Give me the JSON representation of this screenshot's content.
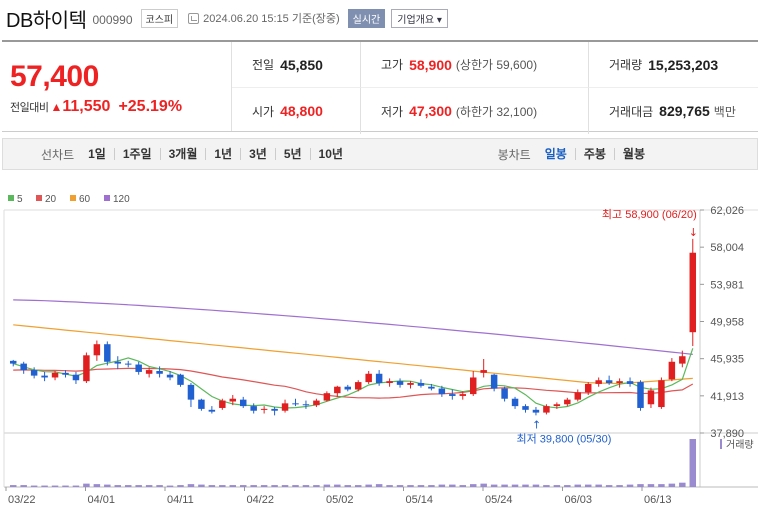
{
  "header": {
    "name": "DB하이텍",
    "code": "000990",
    "market": "코스피",
    "timestamp": "2024.06.20 15:15 기준(장중)",
    "realtime": "실시간",
    "company_info": "기업개요 ▾"
  },
  "quote": {
    "price": "57,400",
    "change_label": "전일대비",
    "change_arrow": "▲",
    "change": "11,550",
    "change_pct": "+25.19%",
    "prev_close_label": "전일",
    "prev_close": "45,850",
    "high_label": "고가",
    "high": "58,900",
    "upper_limit": "(상한가 59,600)",
    "volume_label": "거래량",
    "volume": "15,253,203",
    "open_label": "시가",
    "open": "48,800",
    "low_label": "저가",
    "low": "47,300",
    "lower_limit": "(하한가 32,100)",
    "value_label": "거래대금",
    "value": "829,765",
    "value_unit": "백만"
  },
  "period_bar": {
    "line_title": "선차트",
    "line_items": [
      "1일",
      "1주일",
      "3개월",
      "1년",
      "3년",
      "5년",
      "10년"
    ],
    "candle_title": "봉차트",
    "candle_items": [
      "일봉",
      "주봉",
      "월봉"
    ],
    "active": "일봉"
  },
  "chart_data": {
    "type": "candlestick",
    "legend": [
      {
        "label": "5",
        "color": "#5cb85c"
      },
      {
        "label": "20",
        "color": "#e05555"
      },
      {
        "label": "60",
        "color": "#f0a030"
      },
      {
        "label": "120",
        "color": "#a070d0"
      }
    ],
    "y_ticks": [
      "62,026",
      "58,004",
      "53,981",
      "49,958",
      "45,935",
      "41,913",
      "37,890"
    ],
    "ylim": [
      37890,
      62026
    ],
    "x_ticks": [
      "03/22",
      "04/01",
      "04/11",
      "04/22",
      "05/02",
      "05/14",
      "05/24",
      "06/03",
      "06/13"
    ],
    "annotation_high": "최고 58,900 (06/20)",
    "annotation_low": "최저 39,800 (05/30)",
    "volume_label": "거래량",
    "up_color": "#e02020",
    "down_color": "#2060d0",
    "candles": [
      [
        45700,
        45800,
        45100,
        45400
      ],
      [
        45400,
        45600,
        44300,
        44700
      ],
      [
        44700,
        45000,
        43800,
        44100
      ],
      [
        44100,
        44500,
        43500,
        43900
      ],
      [
        43900,
        44600,
        43600,
        44400
      ],
      [
        44400,
        44700,
        43900,
        44200
      ],
      [
        44200,
        44500,
        43200,
        43600
      ],
      [
        43500,
        46600,
        43300,
        46300
      ],
      [
        46300,
        47900,
        45700,
        47500
      ],
      [
        47500,
        47800,
        45200,
        45600
      ],
      [
        45600,
        46200,
        44800,
        45400
      ],
      [
        45400,
        45700,
        45000,
        45300
      ],
      [
        45300,
        45600,
        44200,
        44500
      ],
      [
        44300,
        45000,
        43900,
        44700
      ],
      [
        44600,
        45100,
        43900,
        44300
      ],
      [
        44200,
        44600,
        43600,
        43900
      ],
      [
        44200,
        44300,
        42900,
        43100
      ],
      [
        43100,
        43300,
        40700,
        41500
      ],
      [
        41500,
        41600,
        40300,
        40500
      ],
      [
        40400,
        40800,
        40000,
        40200
      ],
      [
        40600,
        41600,
        40400,
        41400
      ],
      [
        41300,
        42000,
        40900,
        41600
      ],
      [
        41500,
        41800,
        40600,
        40800
      ],
      [
        40800,
        41100,
        40000,
        40300
      ],
      [
        40400,
        40800,
        40000,
        40500
      ],
      [
        40500,
        40700,
        39800,
        40300
      ],
      [
        40300,
        41500,
        40100,
        41100
      ],
      [
        41100,
        41600,
        40800,
        41000
      ],
      [
        41000,
        41400,
        40500,
        40900
      ],
      [
        40900,
        41600,
        40700,
        41400
      ],
      [
        41400,
        42400,
        41300,
        42200
      ],
      [
        42200,
        43000,
        41800,
        42900
      ],
      [
        42900,
        43100,
        42400,
        42600
      ],
      [
        42600,
        43600,
        42400,
        43400
      ],
      [
        43400,
        44600,
        43200,
        44300
      ],
      [
        44300,
        44700,
        43000,
        43300
      ],
      [
        43300,
        43800,
        42900,
        43500
      ],
      [
        43500,
        43800,
        42800,
        43100
      ],
      [
        43100,
        43500,
        42700,
        43300
      ],
      [
        43300,
        43700,
        42800,
        43000
      ],
      [
        42900,
        43200,
        42500,
        42700
      ],
      [
        42700,
        43000,
        41800,
        42100
      ],
      [
        42100,
        42600,
        41500,
        41900
      ],
      [
        41900,
        42400,
        41500,
        42100
      ],
      [
        42100,
        44600,
        41900,
        43900
      ],
      [
        44400,
        45900,
        43900,
        44700
      ],
      [
        44200,
        44300,
        42400,
        42700
      ],
      [
        42700,
        42900,
        41300,
        41600
      ],
      [
        41600,
        41800,
        40500,
        40800
      ],
      [
        40800,
        41000,
        40100,
        40400
      ],
      [
        40400,
        40700,
        39800,
        40100
      ],
      [
        40100,
        41000,
        39900,
        40800
      ],
      [
        40800,
        41200,
        40500,
        41000
      ],
      [
        41000,
        41700,
        40800,
        41500
      ],
      [
        41500,
        42600,
        41300,
        42300
      ],
      [
        42300,
        43400,
        42000,
        43200
      ],
      [
        43200,
        43900,
        42900,
        43600
      ],
      [
        43600,
        44100,
        43100,
        43300
      ],
      [
        43300,
        43800,
        42800,
        43500
      ],
      [
        43500,
        43900,
        42900,
        43200
      ],
      [
        43400,
        43600,
        40300,
        40600
      ],
      [
        41000,
        42800,
        40600,
        42500
      ],
      [
        40700,
        43900,
        40500,
        43600
      ],
      [
        43700,
        46000,
        43500,
        45600
      ],
      [
        45400,
        46800,
        45000,
        46200
      ],
      [
        48800,
        58900,
        47300,
        57400
      ]
    ],
    "volumes": [
      4,
      4,
      3,
      3,
      3,
      3,
      3,
      7,
      6,
      5,
      4,
      4,
      4,
      4,
      4,
      3,
      4,
      6,
      5,
      4,
      4,
      4,
      4,
      4,
      4,
      4,
      4,
      4,
      4,
      4,
      5,
      5,
      4,
      4,
      5,
      6,
      4,
      4,
      4,
      4,
      4,
      5,
      5,
      4,
      6,
      7,
      5,
      5,
      5,
      5,
      5,
      4,
      4,
      4,
      5,
      5,
      5,
      4,
      4,
      5,
      6,
      6,
      6,
      7,
      9,
      100
    ],
    "ma_base": {
      "ma20_start": 44700,
      "ma60_start": 49600,
      "ma120_start": 52300
    }
  }
}
